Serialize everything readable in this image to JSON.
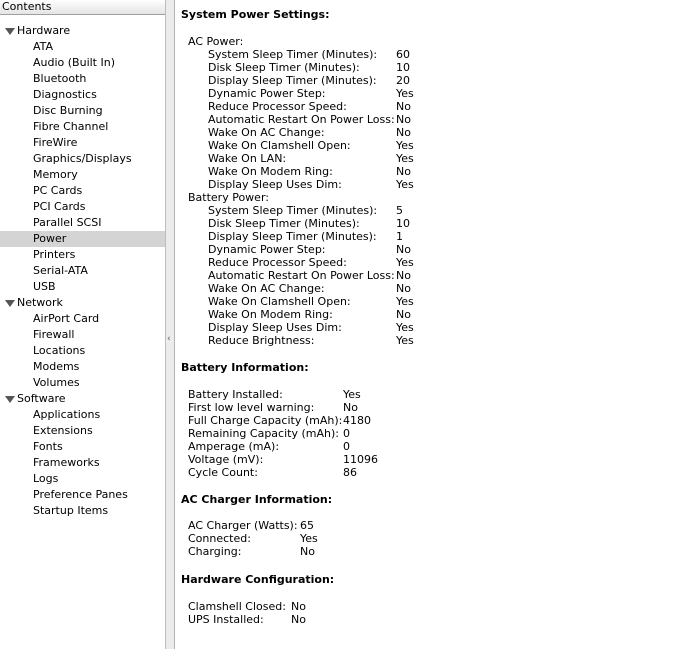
{
  "sidebar": {
    "header": "Contents",
    "categories": [
      {
        "label": "Hardware",
        "items": [
          "ATA",
          "Audio (Built In)",
          "Bluetooth",
          "Diagnostics",
          "Disc Burning",
          "Fibre Channel",
          "FireWire",
          "Graphics/Displays",
          "Memory",
          "PC Cards",
          "PCI Cards",
          "Parallel SCSI",
          "Power",
          "Printers",
          "Serial-ATA",
          "USB"
        ]
      },
      {
        "label": "Network",
        "items": [
          "AirPort Card",
          "Firewall",
          "Locations",
          "Modems",
          "Volumes"
        ]
      },
      {
        "label": "Software",
        "items": [
          "Applications",
          "Extensions",
          "Fonts",
          "Frameworks",
          "Logs",
          "Preference Panes",
          "Startup Items"
        ]
      }
    ],
    "selected": "Power"
  },
  "splitter": {
    "arrow_glyph": "‹"
  },
  "main": {
    "system_power": {
      "title": "System Power Settings:",
      "ac": {
        "label": "AC Power:",
        "rows": [
          [
            "System Sleep Timer (Minutes):",
            "60"
          ],
          [
            "Disk Sleep Timer (Minutes):",
            "10"
          ],
          [
            "Display Sleep Timer (Minutes):",
            "20"
          ],
          [
            "Dynamic Power Step:",
            "Yes"
          ],
          [
            "Reduce Processor Speed:",
            "No"
          ],
          [
            "Automatic Restart On Power Loss:",
            "No"
          ],
          [
            "Wake On AC Change:",
            "No"
          ],
          [
            "Wake On Clamshell Open:",
            "Yes"
          ],
          [
            "Wake On LAN:",
            "Yes"
          ],
          [
            "Wake On Modem Ring:",
            "No"
          ],
          [
            "Display Sleep Uses Dim:",
            "Yes"
          ]
        ]
      },
      "battery": {
        "label": "Battery Power:",
        "rows": [
          [
            "System Sleep Timer (Minutes):",
            "5"
          ],
          [
            "Disk Sleep Timer (Minutes):",
            "10"
          ],
          [
            "Display Sleep Timer (Minutes):",
            "1"
          ],
          [
            "Dynamic Power Step:",
            "No"
          ],
          [
            "Reduce Processor Speed:",
            "Yes"
          ],
          [
            "Automatic Restart On Power Loss:",
            "No"
          ],
          [
            "Wake On AC Change:",
            "No"
          ],
          [
            "Wake On Clamshell Open:",
            "Yes"
          ],
          [
            "Wake On Modem Ring:",
            "No"
          ],
          [
            "Display Sleep Uses Dim:",
            "Yes"
          ],
          [
            "Reduce Brightness:",
            "Yes"
          ]
        ]
      }
    },
    "battery_info": {
      "title": "Battery Information:",
      "rows": [
        [
          "Battery Installed:",
          "Yes"
        ],
        [
          "First low level warning:",
          "No"
        ],
        [
          "Full Charge Capacity (mAh):",
          "4180"
        ],
        [
          "Remaining Capacity (mAh):",
          "0"
        ],
        [
          "Amperage (mA):",
          "0"
        ],
        [
          "Voltage (mV):",
          "11096"
        ],
        [
          "Cycle Count:",
          "86"
        ]
      ]
    },
    "charger_info": {
      "title": "AC Charger Information:",
      "rows": [
        [
          "AC Charger (Watts):",
          "65"
        ],
        [
          "Connected:",
          "Yes"
        ],
        [
          "Charging:",
          "No"
        ]
      ]
    },
    "hardware_config": {
      "title": "Hardware Configuration:",
      "rows": [
        [
          "Clamshell Closed:",
          "No"
        ],
        [
          "UPS Installed:",
          "No"
        ]
      ]
    }
  }
}
